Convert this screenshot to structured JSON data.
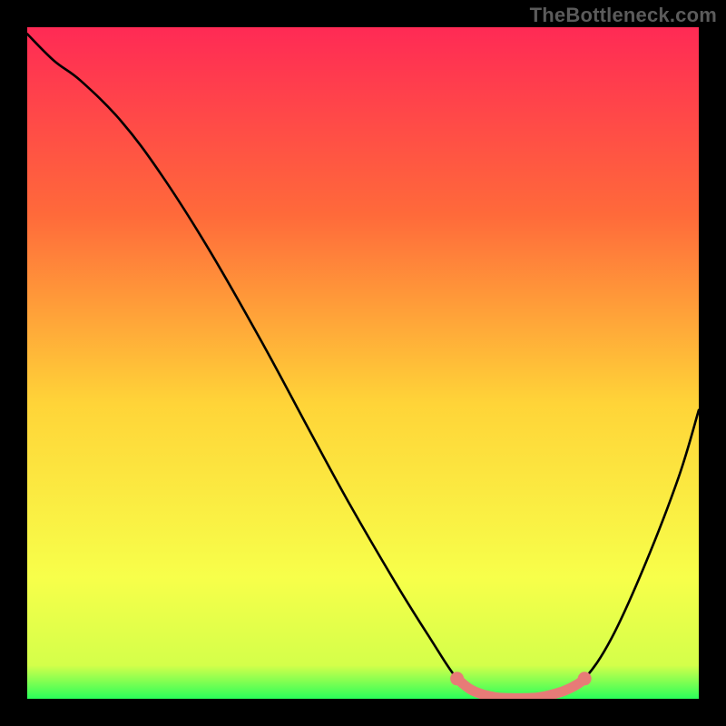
{
  "watermark": "TheBottleneck.com",
  "colors": {
    "bg_black": "#000000",
    "gradient_top": "#ff2a55",
    "gradient_mid_upper": "#ff6a3a",
    "gradient_mid": "#ffd438",
    "gradient_mid_lower": "#f7ff4a",
    "gradient_bottom": "#2aff5a",
    "curve": "#000000",
    "marker": "#e77b77",
    "watermark": "#5b5b5b"
  },
  "chart_data": {
    "type": "line",
    "title": "",
    "xlabel": "",
    "ylabel": "",
    "xlim": [
      0,
      100
    ],
    "ylim": [
      0,
      100
    ],
    "curve": [
      {
        "x": 0,
        "y": 99
      },
      {
        "x": 4,
        "y": 95
      },
      {
        "x": 8,
        "y": 92
      },
      {
        "x": 14,
        "y": 86
      },
      {
        "x": 20,
        "y": 78
      },
      {
        "x": 27,
        "y": 67
      },
      {
        "x": 35,
        "y": 53
      },
      {
        "x": 42,
        "y": 40
      },
      {
        "x": 48,
        "y": 29
      },
      {
        "x": 55,
        "y": 17
      },
      {
        "x": 60,
        "y": 9
      },
      {
        "x": 64,
        "y": 3
      },
      {
        "x": 67,
        "y": 1
      },
      {
        "x": 70,
        "y": 0
      },
      {
        "x": 75,
        "y": 0
      },
      {
        "x": 80,
        "y": 1
      },
      {
        "x": 83,
        "y": 3
      },
      {
        "x": 87,
        "y": 9
      },
      {
        "x": 92,
        "y": 20
      },
      {
        "x": 97,
        "y": 33
      },
      {
        "x": 100,
        "y": 43
      }
    ],
    "highlight_segment": [
      {
        "x": 64,
        "y": 3.0
      },
      {
        "x": 66,
        "y": 1.4
      },
      {
        "x": 68,
        "y": 0.6
      },
      {
        "x": 70,
        "y": 0.2
      },
      {
        "x": 72,
        "y": 0.1
      },
      {
        "x": 74,
        "y": 0.1
      },
      {
        "x": 76,
        "y": 0.2
      },
      {
        "x": 78,
        "y": 0.6
      },
      {
        "x": 80,
        "y": 1.2
      },
      {
        "x": 82,
        "y": 2.2
      },
      {
        "x": 83,
        "y": 3.0
      }
    ],
    "markers": [
      {
        "x": 64,
        "y": 3.0
      },
      {
        "x": 83,
        "y": 3.0
      }
    ]
  }
}
